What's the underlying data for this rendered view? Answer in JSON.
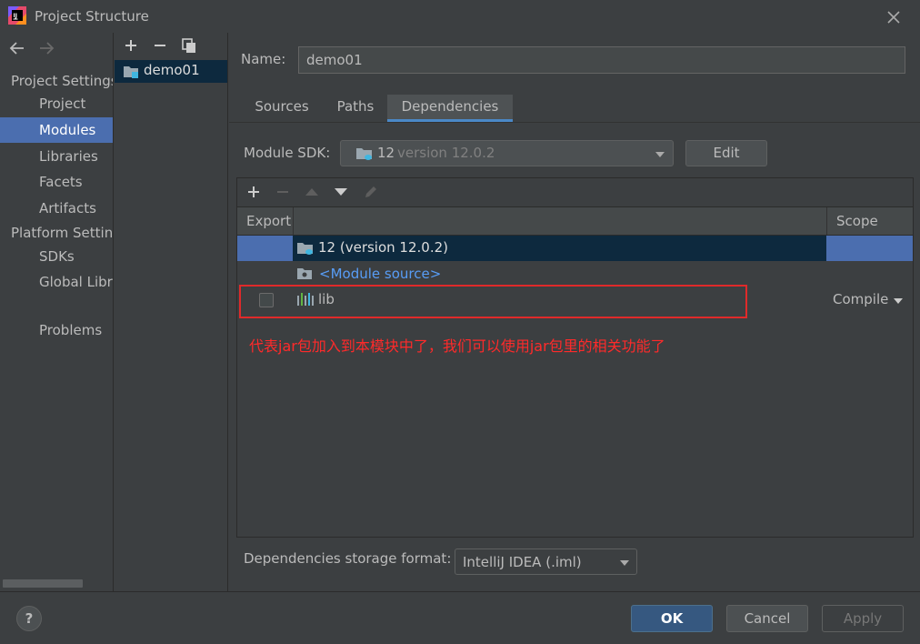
{
  "window": {
    "title": "Project Structure"
  },
  "nav": {
    "project_settings_header": "Project Settings",
    "project_items": [
      "Project",
      "Modules",
      "Libraries",
      "Facets",
      "Artifacts"
    ],
    "platform_settings_header": "Platform Settings",
    "platform_items": [
      "SDKs",
      "Global Libraries"
    ],
    "problems": "Problems",
    "selected": "Modules"
  },
  "modules": {
    "items": [
      "demo01"
    ]
  },
  "module": {
    "name_label": "Name:",
    "name_value": "demo01",
    "tabs": [
      "Sources",
      "Paths",
      "Dependencies"
    ],
    "active_tab": "Dependencies",
    "sdk_label": "Module SDK:",
    "sdk_name": "12",
    "sdk_version": "version 12.0.2",
    "edit_label": "Edit"
  },
  "dependencies": {
    "columns": {
      "export": "Export",
      "scope": "Scope"
    },
    "rows": [
      {
        "name": "12 (version 12.0.2)",
        "scope": "",
        "kind": "sdk"
      },
      {
        "name": "<Module source>",
        "scope": "",
        "kind": "source"
      },
      {
        "name": "lib",
        "scope": "Compile",
        "kind": "library",
        "export": false
      }
    ]
  },
  "annotation": "代表jar包加入到本模块中了，我们可以使用jar包里的相关功能了",
  "storage": {
    "label": "Dependencies storage format:",
    "value": "IntelliJ IDEA (.iml)"
  },
  "buttons": {
    "ok": "OK",
    "cancel": "Cancel",
    "apply": "Apply",
    "help": "?"
  },
  "colors": {
    "selection": "#4b6eaf",
    "annotation": "#ff2a2a",
    "link": "#589df6"
  }
}
